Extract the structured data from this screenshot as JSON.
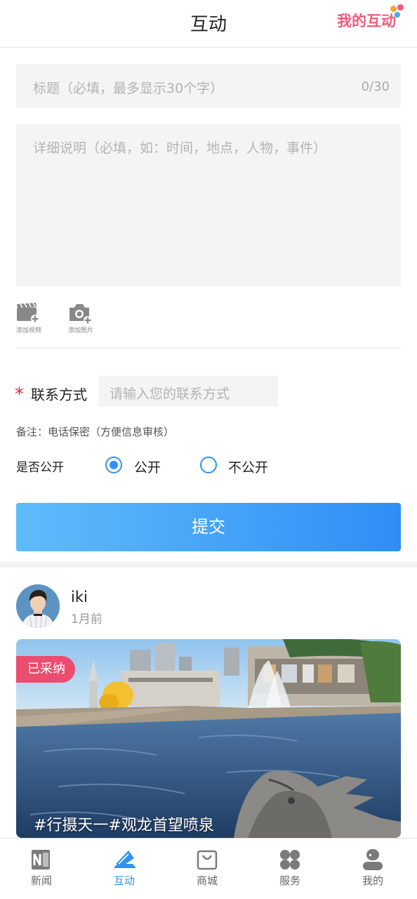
{
  "header": {
    "title": "互动",
    "my_interaction_label": "我的互动"
  },
  "form": {
    "title_placeholder": "标题（必填，最多显示30个字）",
    "title_counter": "0/30",
    "description_placeholder": "详细说明（必填，如：时间，地点，人物，事件）",
    "add_video_label": "添加视频",
    "add_photo_label": "添加图片",
    "contact_required_mark": "*",
    "contact_label": "联系方式",
    "contact_placeholder": "请输入您的联系方式",
    "note": "备注：电话保密（方便信息审核）",
    "public_label": "是否公开",
    "options": [
      {
        "label": "公开",
        "selected": true
      },
      {
        "label": "不公开",
        "selected": false
      }
    ],
    "submit_label": "提交"
  },
  "post": {
    "username": "iki",
    "time": "1月前",
    "badge": "已采纳",
    "caption": "#行摄天一#观龙首望喷泉"
  },
  "tabs": [
    {
      "label": "新闻",
      "icon": "news-icon",
      "active": false
    },
    {
      "label": "互动",
      "icon": "interaction-icon",
      "active": true
    },
    {
      "label": "商城",
      "icon": "shop-bag-icon",
      "active": false
    },
    {
      "label": "服务",
      "icon": "services-grid-icon",
      "active": false
    },
    {
      "label": "我的",
      "icon": "profile-icon",
      "active": false
    }
  ],
  "colors": {
    "accent": "#2f92f0",
    "brand_pink": "#ec4d6f",
    "required_red": "#d9313b"
  }
}
